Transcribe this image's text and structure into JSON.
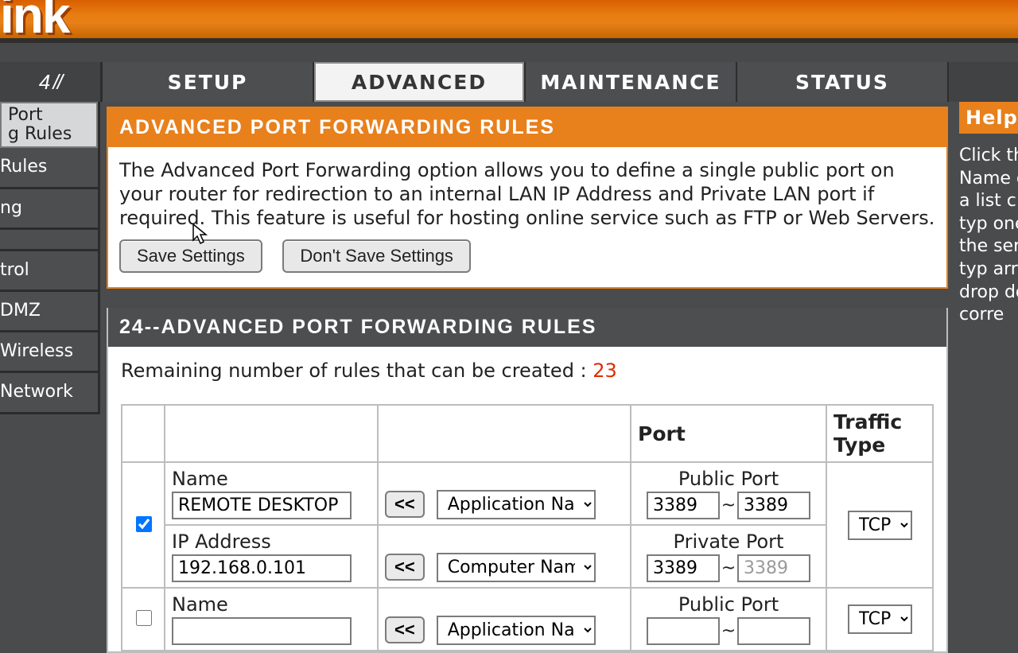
{
  "brand": {
    "logo_fragment": "ink"
  },
  "nav": {
    "model_stub": "4 //",
    "tabs": [
      "SETUP",
      "ADVANCED",
      "MAINTENANCE",
      "STATUS"
    ],
    "active": 1
  },
  "sidebar": {
    "items": [
      "Port\ng Rules",
      "Rules",
      "ng",
      "",
      "trol",
      "DMZ",
      "Wireless",
      "Network"
    ],
    "selected": 0
  },
  "panel": {
    "title": "ADVANCED PORT FORWARDING RULES",
    "description": "The Advanced Port Forwarding option allows you to define a single public port on your router for redirection to an internal LAN IP Address and Private LAN port if required. This feature is useful for hosting online service such as FTP or Web Servers.",
    "save_label": "Save Settings",
    "dont_save_label": "Don't Save Settings"
  },
  "rules": {
    "title": "24--ADVANCED PORT FORWARDING RULES",
    "remaining_label": "Remaining number of rules that can be created : ",
    "remaining_count": "23",
    "columns": {
      "checkbox": "",
      "name_app": "",
      "copy": "",
      "port": "Port",
      "traffic": "Traffic Type"
    },
    "labels": {
      "name": "Name",
      "ip": "IP Address",
      "public_port": "Public Port",
      "private_port": "Private Port"
    },
    "dropdown_app_placeholder": "Application Name",
    "dropdown_comp_placeholder": "Computer Name",
    "copy_btn_label": "<<",
    "rows": [
      {
        "enabled": true,
        "name": "REMOTE DESKTOP",
        "ip": "192.168.0.101",
        "public_port_from": "3389",
        "public_port_to": "3389",
        "private_port_from": "3389",
        "private_port_to": "3389",
        "traffic": "TCP"
      },
      {
        "enabled": false,
        "name": "",
        "ip": "",
        "public_port_from": "",
        "public_port_to": "",
        "private_port_from": "",
        "private_port_to": "",
        "traffic": "TCP"
      }
    ]
  },
  "help": {
    "title": "Helpful H",
    "body": "Click the A\nName dr\nfor a list c\nserver typ\none of the\nserver typ\narrow but\ndrop dow\nthe corre"
  }
}
